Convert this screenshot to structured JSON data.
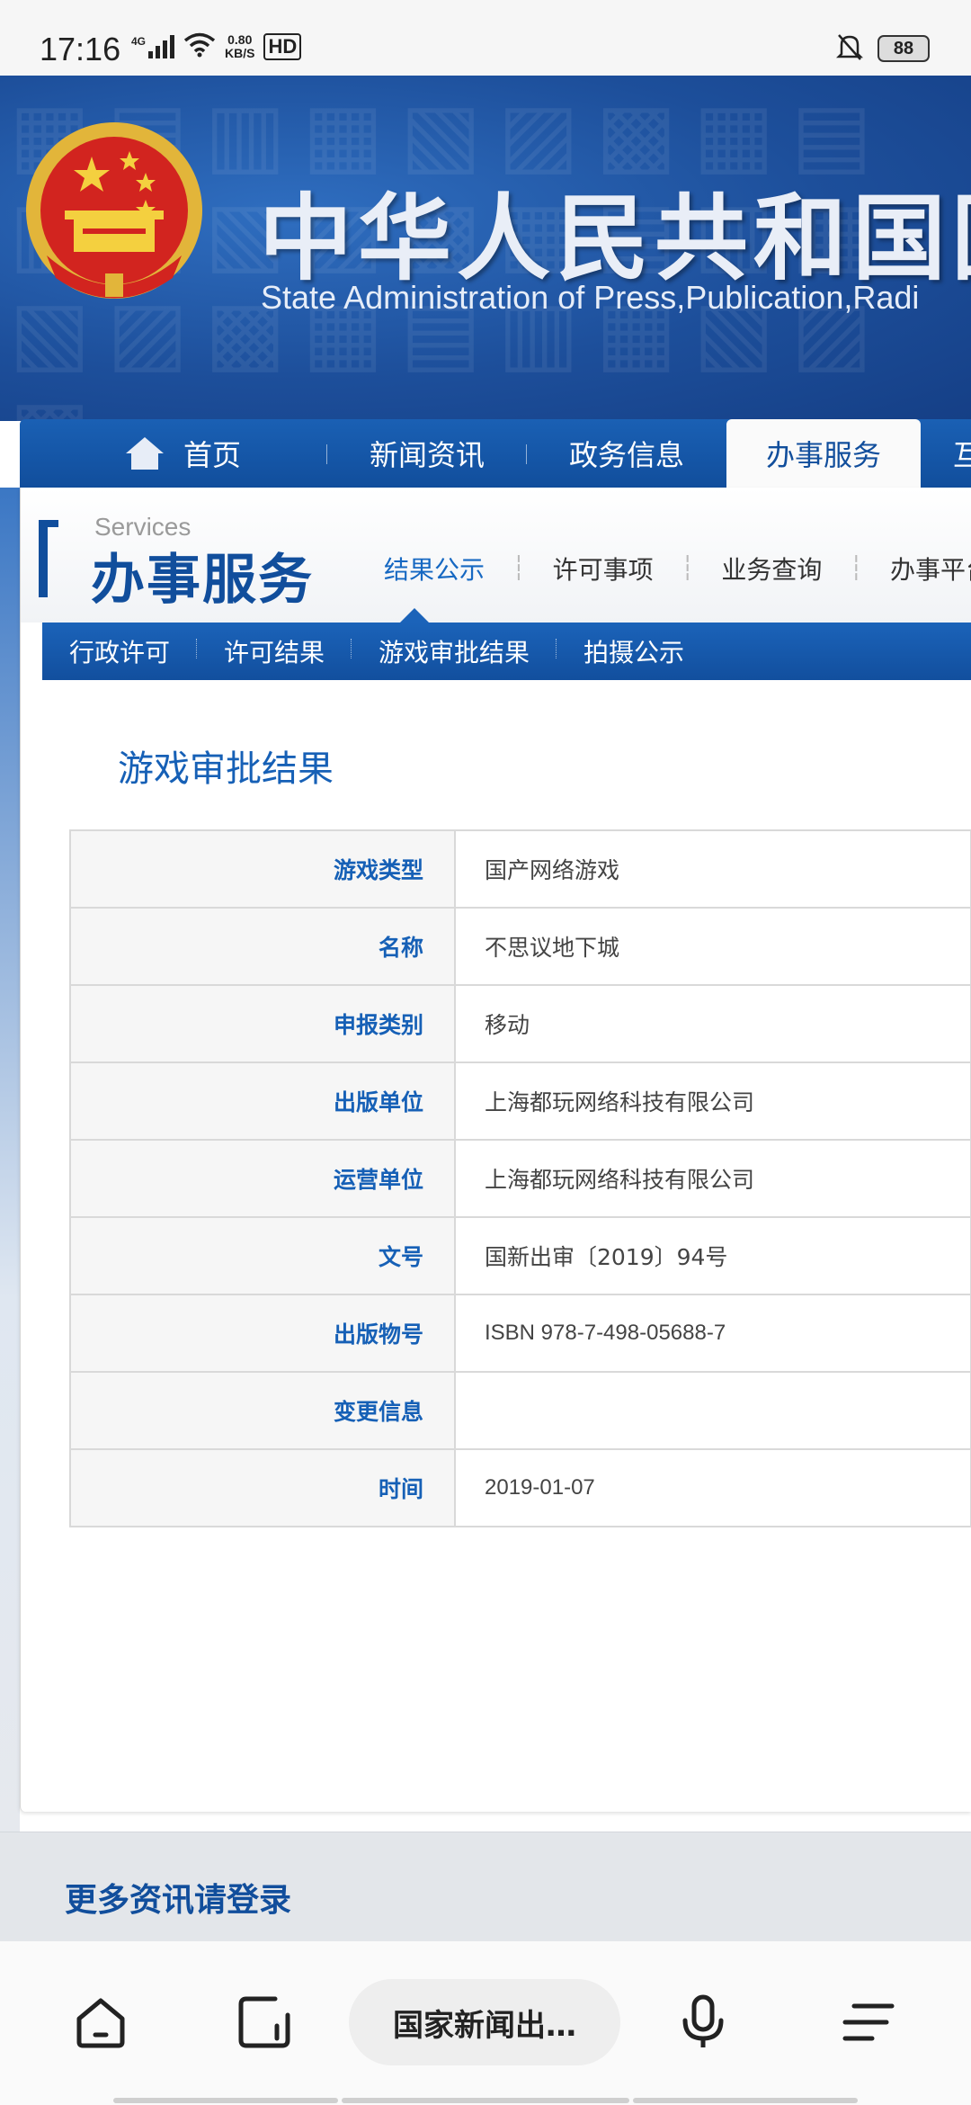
{
  "status_bar": {
    "time": "17:16",
    "network_type": "4G",
    "speed_value": "0.80",
    "speed_unit": "KB/S",
    "hd": "HD",
    "battery": "88"
  },
  "header": {
    "title": "中华人民共和国国",
    "subtitle_en": "State Administration of Press,Publication,Radi"
  },
  "main_nav": {
    "items": [
      {
        "label": "首页"
      },
      {
        "label": "新闻资讯"
      },
      {
        "label": "政务信息"
      },
      {
        "label": "办事服务"
      },
      {
        "label": "互"
      }
    ]
  },
  "services": {
    "en_label": "Services",
    "title": "办事服务",
    "links": [
      {
        "label": "结果公示"
      },
      {
        "label": "许可事项"
      },
      {
        "label": "业务查询"
      },
      {
        "label": "办事平台"
      }
    ],
    "subnav": [
      {
        "label": "行政许可"
      },
      {
        "label": "许可结果"
      },
      {
        "label": "游戏审批结果"
      },
      {
        "label": "拍摄公示"
      }
    ]
  },
  "page_title": "游戏审批结果",
  "table": {
    "rows": [
      {
        "key": "游戏类型",
        "value": "国产网络游戏"
      },
      {
        "key": "名称",
        "value": "不思议地下城"
      },
      {
        "key": "申报类别",
        "value": "移动"
      },
      {
        "key": "出版单位",
        "value": "上海都玩网络科技有限公司"
      },
      {
        "key": "运营单位",
        "value": "上海都玩网络科技有限公司"
      },
      {
        "key": "文号",
        "value": "国新出审〔2019〕94号"
      },
      {
        "key": "出版物号",
        "value": "ISBN 978-7-498-05688-7"
      },
      {
        "key": "变更信息",
        "value": ""
      },
      {
        "key": "时间",
        "value": "2019-01-07"
      }
    ]
  },
  "footer": {
    "login_prompt": "更多资讯请登录"
  },
  "browser_bar": {
    "url_title": "国家新闻出…",
    "icons": [
      "home-icon",
      "tabs-icon",
      "microphone-icon",
      "menu-icon"
    ]
  },
  "colors": {
    "brand_blue": "#114e9c",
    "link_blue": "#1660b6",
    "banner_blue": "#1d4f9b"
  }
}
